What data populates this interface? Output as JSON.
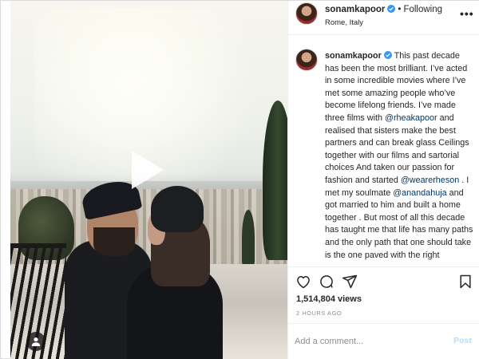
{
  "post": {
    "username": "sonamkapoor",
    "follow_status": "Following",
    "separator": "•",
    "location": "Rome, Italy",
    "more_label": "•••",
    "verified_icon": "verified-badge-icon",
    "accent_color": "#3897f0"
  },
  "caption": {
    "username": "sonamkapoor",
    "part1": " This past decade has been the most brilliant. I’ve acted in some incredible movies where I’ve met some amazing people who’ve become lifelong friends. I’ve made three films with ",
    "mention1": "@rheakapoor",
    "part2": " and realised that sisters make the best partners and can break glass Ceilings together with our films and sartorial choices And taken our passion for fashion and started ",
    "mention2": "@wearerheson",
    "part3": " . I met my soulmate ",
    "mention3": "@anandahuja",
    "part4": " and got married to him and built a home together . But most of all this decade has taught me that life has many paths and the only path that one should take is the one paved with the right intentions. Thank you to my family and friends, thank you to films and fashion. You make me whole. May love lead your way! 🖤"
  },
  "stats": {
    "likes": "1,514,804 views",
    "time": "2 HOURS AGO"
  },
  "comment": {
    "placeholder": "Add a comment...",
    "post_label": "Post"
  },
  "icons": {
    "play": "play-icon",
    "tag": "user-tag-icon",
    "like": "heart-icon",
    "comment": "comment-icon",
    "share": "share-icon",
    "save": "bookmark-icon"
  }
}
